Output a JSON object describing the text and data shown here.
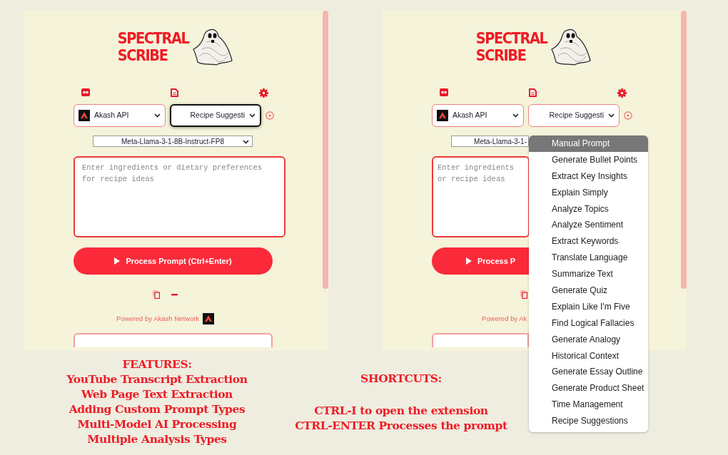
{
  "panels": [
    {
      "logo": {
        "line_1": "SPECTRAL",
        "line_2": "SCRIBE"
      },
      "api_select": "Akash API",
      "prompt_select": {
        "value": "Recipe Suggesti",
        "focused": true
      },
      "model_select": "Meta-Llama-3-1-8B-Instruct-FP8",
      "prompt_input": {
        "placeholder": "Enter ingredients or dietary preferences for recipe ideas"
      },
      "process_button": "Process Prompt (Ctrl+Enter)",
      "powered_by": "Powered by Akash Network"
    },
    {
      "logo": {
        "line_1": "SPECTRAL",
        "line_2": "SCRIBE"
      },
      "api_select": "Akash API",
      "prompt_select": {
        "value": "Recipe Suggesti",
        "focused": false
      },
      "model_select": "Meta-Llama-3-1-",
      "prompt_input": {
        "placeholder": "Enter ingredients or recipe ideas"
      },
      "process_button": "Process P",
      "powered_by": "Powered by Ak",
      "prompt_menu": [
        {
          "label": "Manual Prompt",
          "selected": true
        },
        {
          "label": "Generate Bullet Points",
          "selected": false
        },
        {
          "label": "Extract Key Insights",
          "selected": false
        },
        {
          "label": "Explain Simply",
          "selected": false
        },
        {
          "label": "Analyze Topics",
          "selected": false
        },
        {
          "label": "Analyze Sentiment",
          "selected": false
        },
        {
          "label": "Extract Keywords",
          "selected": false
        },
        {
          "label": "Translate Language",
          "selected": false
        },
        {
          "label": "Summarize Text",
          "selected": false
        },
        {
          "label": "Generate Quiz",
          "selected": false
        },
        {
          "label": "Explain Like I'm Five",
          "selected": false
        },
        {
          "label": "Find Logical Fallacies",
          "selected": false
        },
        {
          "label": "Generate Analogy",
          "selected": false
        },
        {
          "label": "Historical Context",
          "selected": false
        },
        {
          "label": "Generate Essay Outline",
          "selected": false
        },
        {
          "label": "Generate Product Sheet",
          "selected": false
        },
        {
          "label": "Time Management",
          "selected": false
        },
        {
          "label": "Recipe Suggestions",
          "selected": false
        }
      ]
    }
  ],
  "features": {
    "title": "FEATURES:",
    "items": [
      "YouTube Transcript Extraction",
      "Web Page Text Extraction",
      "Adding Custom Prompt Types",
      "Multi-Model AI Processing",
      "Multiple Analysis Types"
    ]
  },
  "shortcuts": {
    "title": "SHORTCUTS:",
    "items": [
      "CTRL-I to open the extension",
      "CTRL-ENTER Processes the prompt"
    ]
  }
}
